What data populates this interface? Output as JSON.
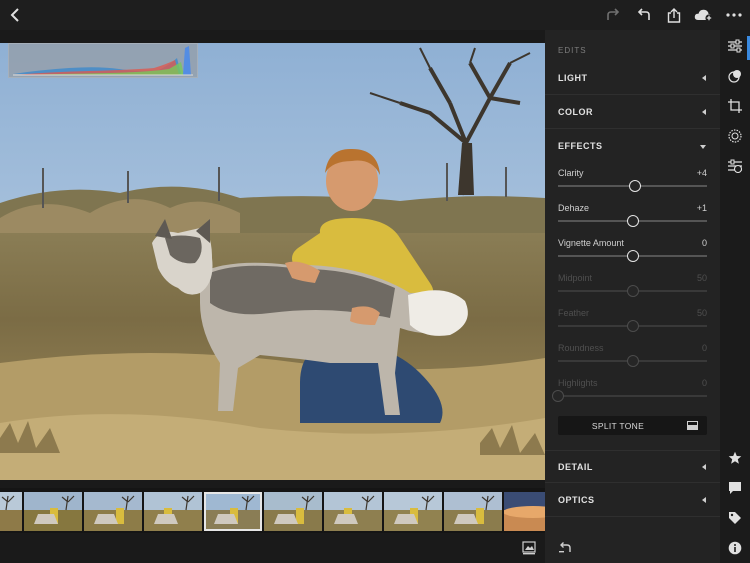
{
  "toolbar": {
    "icons": [
      "chevron-left-icon",
      "redo-icon",
      "undo-icon",
      "share-icon",
      "cloud-add-icon",
      "more-icon"
    ]
  },
  "panel": {
    "edits_label": "EDITS",
    "sections": {
      "light": "LIGHT",
      "color": "COLOR",
      "effects": "EFFECTS",
      "detail": "DETAIL",
      "optics": "OPTICS"
    },
    "effects": {
      "clarity": {
        "label": "Clarity",
        "value": "+4",
        "level": 0.52,
        "disabled": false
      },
      "dehaze": {
        "label": "Dehaze",
        "value": "+1",
        "level": 0.505,
        "disabled": false
      },
      "vignette_amount": {
        "label": "Vignette Amount",
        "value": "0",
        "level": 0.5,
        "disabled": false
      },
      "midpoint": {
        "label": "Midpoint",
        "value": "50",
        "level": 0.5,
        "disabled": true
      },
      "feather": {
        "label": "Feather",
        "value": "50",
        "level": 0.5,
        "disabled": true
      },
      "roundness": {
        "label": "Roundness",
        "value": "0",
        "level": 0.5,
        "disabled": true
      },
      "highlights": {
        "label": "Highlights",
        "value": "0",
        "level": 0.0,
        "disabled": true
      }
    },
    "split_tone_label": "SPLIT TONE"
  },
  "toolstrip": {
    "icons": [
      "sliders-icon",
      "presets-icon",
      "crop-icon",
      "selective-icon",
      "healing-icon",
      "star-icon",
      "comment-icon",
      "tag-icon",
      "info-icon"
    ],
    "active": "sliders-icon"
  },
  "filmstrip": {
    "thumb_count": 10,
    "selected_index": 3
  },
  "colors": {
    "accent": "#3a8ae0",
    "panel_bg": "#232323",
    "app_bg": "#1a1a1a"
  }
}
